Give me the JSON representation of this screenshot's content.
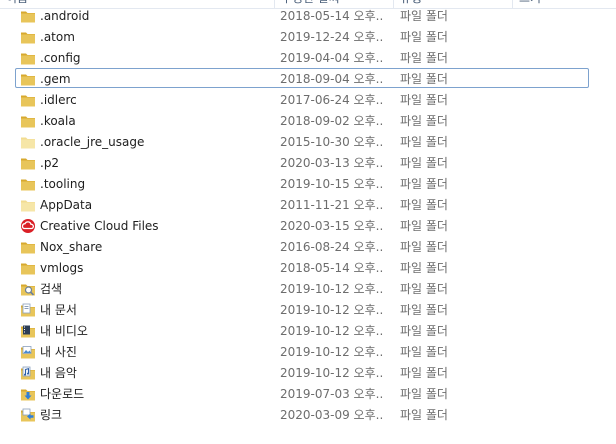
{
  "header": {
    "name_label": "이름",
    "date_label": "수정한 날짜",
    "type_label": "유형",
    "size_label": "크기"
  },
  "files": [
    {
      "name": ".android",
      "date": "2018-05-14 오후...",
      "type": "파일 폴더",
      "icon": "folder-icon",
      "selected": false
    },
    {
      "name": ".atom",
      "date": "2019-12-24 오후...",
      "type": "파일 폴더",
      "icon": "folder-icon",
      "selected": false
    },
    {
      "name": ".config",
      "date": "2019-04-04 오후...",
      "type": "파일 폴더",
      "icon": "folder-icon",
      "selected": false
    },
    {
      "name": ".gem",
      "date": "2018-09-04 오후...",
      "type": "파일 폴더",
      "icon": "folder-icon",
      "selected": true
    },
    {
      "name": ".idlerc",
      "date": "2017-06-24 오후...",
      "type": "파일 폴더",
      "icon": "folder-icon",
      "selected": false
    },
    {
      "name": ".koala",
      "date": "2018-09-02 오후...",
      "type": "파일 폴더",
      "icon": "folder-icon",
      "selected": false
    },
    {
      "name": ".oracle_jre_usage",
      "date": "2015-10-30 오후...",
      "type": "파일 폴더",
      "icon": "folder-empty-icon",
      "selected": false
    },
    {
      "name": ".p2",
      "date": "2020-03-13 오후...",
      "type": "파일 폴더",
      "icon": "folder-icon",
      "selected": false
    },
    {
      "name": ".tooling",
      "date": "2019-10-15 오후...",
      "type": "파일 폴더",
      "icon": "folder-icon",
      "selected": false
    },
    {
      "name": "AppData",
      "date": "2011-11-21 오후...",
      "type": "파일 폴더",
      "icon": "folder-empty-icon",
      "selected": false
    },
    {
      "name": "Creative Cloud Files",
      "date": "2020-03-15 오후...",
      "type": "파일 폴더",
      "icon": "creative-cloud-icon",
      "selected": false
    },
    {
      "name": "Nox_share",
      "date": "2016-08-24 오후...",
      "type": "파일 폴더",
      "icon": "folder-icon",
      "selected": false
    },
    {
      "name": "vmlogs",
      "date": "2018-05-14 오후...",
      "type": "파일 폴더",
      "icon": "folder-icon",
      "selected": false
    },
    {
      "name": "검색",
      "date": "2019-10-12 오후...",
      "type": "파일 폴더",
      "icon": "search-folder-icon",
      "selected": false
    },
    {
      "name": "내 문서",
      "date": "2019-10-12 오후...",
      "type": "파일 폴더",
      "icon": "documents-folder-icon",
      "selected": false
    },
    {
      "name": "내 비디오",
      "date": "2019-10-12 오후...",
      "type": "파일 폴더",
      "icon": "videos-folder-icon",
      "selected": false
    },
    {
      "name": "내 사진",
      "date": "2019-10-12 오후...",
      "type": "파일 폴더",
      "icon": "pictures-folder-icon",
      "selected": false
    },
    {
      "name": "내 음악",
      "date": "2019-10-12 오후...",
      "type": "파일 폴더",
      "icon": "music-folder-icon",
      "selected": false
    },
    {
      "name": "다운로드",
      "date": "2019-07-03 오후...",
      "type": "파일 폴더",
      "icon": "downloads-folder-icon",
      "selected": false
    },
    {
      "name": "링크",
      "date": "2020-03-09 오후...",
      "type": "파일 폴더",
      "icon": "links-folder-icon",
      "selected": false
    }
  ],
  "colors": {
    "folder": "#e8c55a",
    "folder_dark": "#d7a92f",
    "selection_border": "#7da2ce",
    "header_text": "#4c607a",
    "meta_text": "#6d6d6d"
  }
}
